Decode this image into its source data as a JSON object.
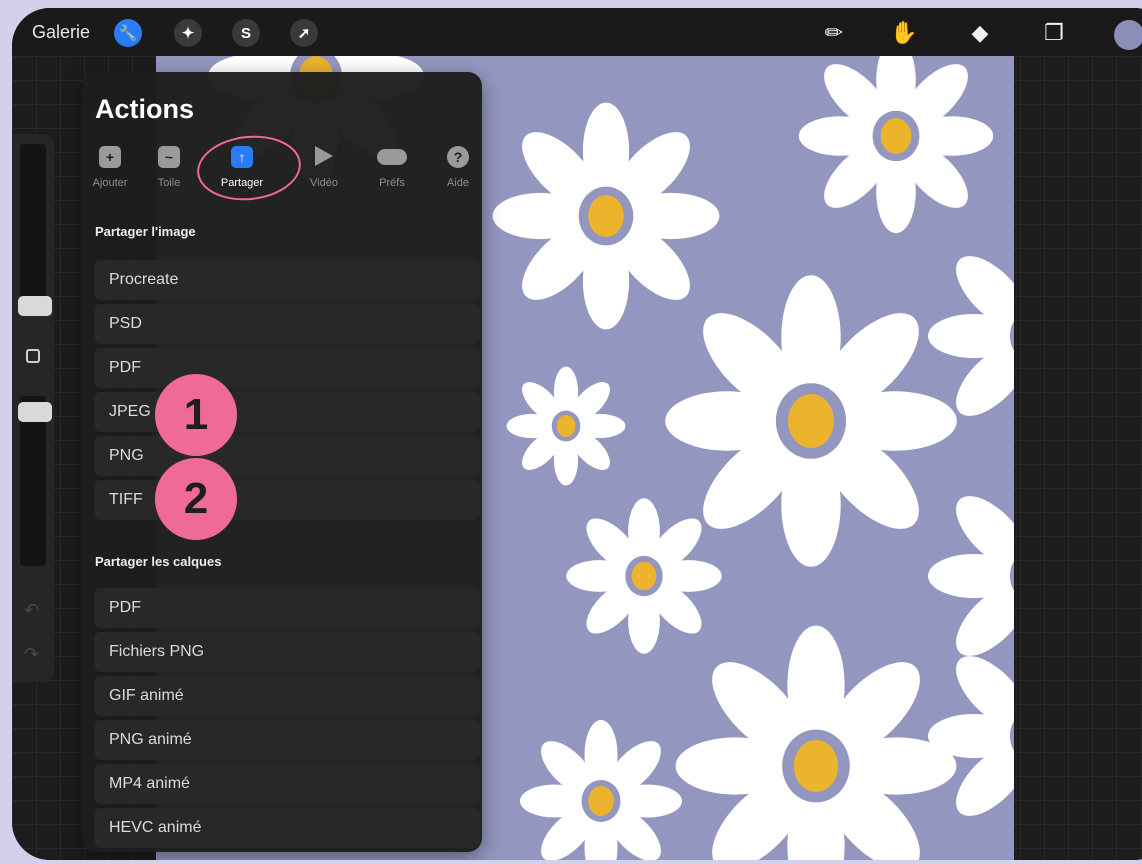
{
  "topbar": {
    "gallery_label": "Galerie",
    "left_icons": [
      "wrench-icon",
      "magic-wand-icon",
      "selection-icon",
      "transform-arrow-icon"
    ],
    "right_icons": [
      "brush-icon",
      "smudge-icon",
      "eraser-icon",
      "layers-icon",
      "color-icon"
    ],
    "active_color": "#8b8fb8"
  },
  "actions_panel": {
    "title": "Actions",
    "tabs": [
      {
        "label": "Ajouter",
        "icon": "add-icon"
      },
      {
        "label": "Toile",
        "icon": "canvas-icon"
      },
      {
        "label": "Partager",
        "icon": "share-icon",
        "active": true
      },
      {
        "label": "Vidéo",
        "icon": "play-icon"
      },
      {
        "label": "Préfs",
        "icon": "toggle-icon"
      },
      {
        "label": "Aide",
        "icon": "help-icon"
      }
    ],
    "share_image": {
      "title": "Partager l'image",
      "options": [
        "Procreate",
        "PSD",
        "PDF",
        "JPEG",
        "PNG",
        "TIFF"
      ]
    },
    "share_layers": {
      "title": "Partager les calques",
      "options": [
        "PDF",
        "Fichiers PNG",
        "GIF animé",
        "PNG animé",
        "MP4 animé",
        "HEVC animé"
      ]
    }
  },
  "annotations": {
    "badge_1": "1",
    "badge_2": "2",
    "highlight_color": "#f06a98"
  },
  "canvas": {
    "background_color": "#9397bf",
    "petal_color": "#ffffff",
    "center_color": "#ecb32c"
  }
}
